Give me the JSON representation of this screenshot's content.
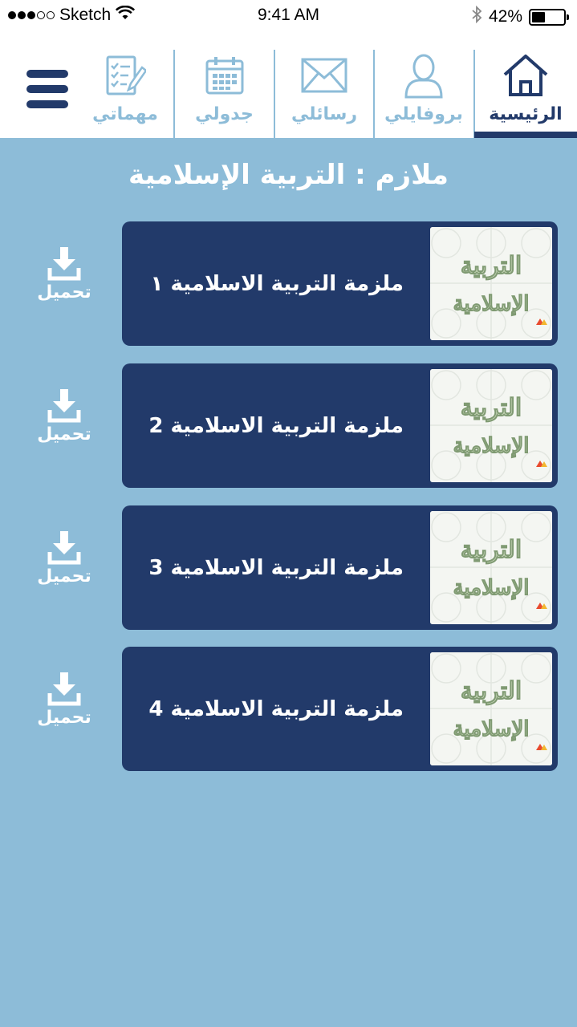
{
  "status_bar": {
    "carrier": "Sketch",
    "time": "9:41 AM",
    "battery_percent": "42%",
    "battery_level": 0.42,
    "signal_dots_filled": 3,
    "signal_dots_total": 5,
    "icons": [
      "wifi-icon",
      "bluetooth-icon",
      "battery-icon"
    ]
  },
  "nav": {
    "tabs": [
      {
        "label": "الرئيسية",
        "icon": "home-icon",
        "active": true
      },
      {
        "label": "بروفايلي",
        "icon": "profile-icon",
        "active": false
      },
      {
        "label": "رسائلي",
        "icon": "mail-icon",
        "active": false
      },
      {
        "label": "جدولي",
        "icon": "calendar-icon",
        "active": false
      },
      {
        "label": "مهماتي",
        "icon": "tasks-icon",
        "active": false
      }
    ],
    "menu_icon": "hamburger-menu-icon"
  },
  "page": {
    "title": "ملازم : التربية الإسلامية"
  },
  "items": [
    {
      "title": "ملزمة التربية الاسلامية ١",
      "download_label": "تحميل"
    },
    {
      "title": "ملزمة التربية الاسلامية 2",
      "download_label": "تحميل"
    },
    {
      "title": "ملزمة التربية الاسلامية 3",
      "download_label": "تحميل"
    },
    {
      "title": "ملزمة التربية الاسلامية 4",
      "download_label": "تحميل"
    }
  ],
  "thumbnail": {
    "calligraphy_text": "التربية الإسلامية"
  },
  "colors": {
    "background": "#8dbcd8",
    "primary": "#223a6a",
    "inactive_tab": "#8dbcd8",
    "white": "#ffffff"
  }
}
